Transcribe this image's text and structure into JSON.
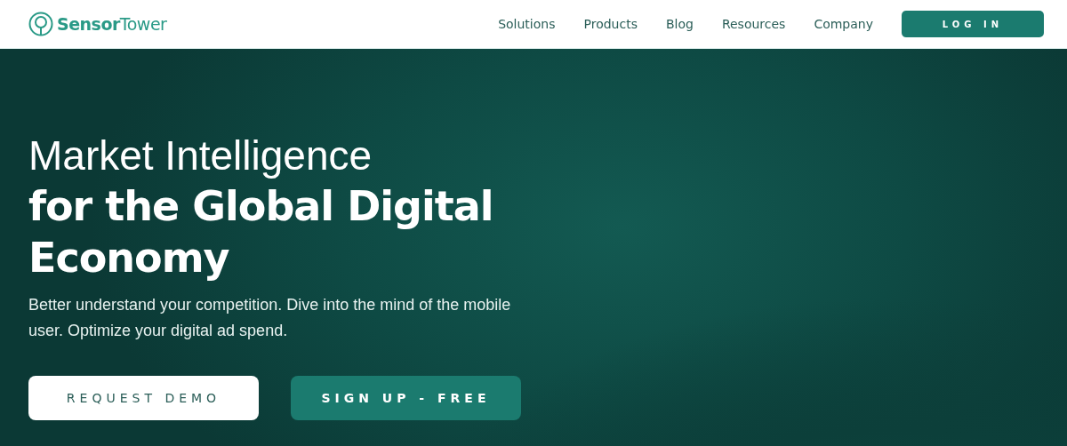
{
  "header": {
    "logo": "**Sensor**Tower",
    "nav": [
      "Solutions",
      "Products",
      "Blog",
      "Resources",
      "Company"
    ],
    "login": "LOG IN"
  },
  "hero": {
    "title_light": "Market Intelligence",
    "title_bold": "for the Global Digital Economy",
    "subtitle": "Better understand your competition. Dive into the mind of the mobile user. Optimize your digital ad spend.",
    "buttons": [
      {
        "label": "REQUEST DEMO",
        "kind": "secondary"
      },
      {
        "label": "SIGN UP - FREE",
        "kind": "primary"
      }
    ]
  }
}
